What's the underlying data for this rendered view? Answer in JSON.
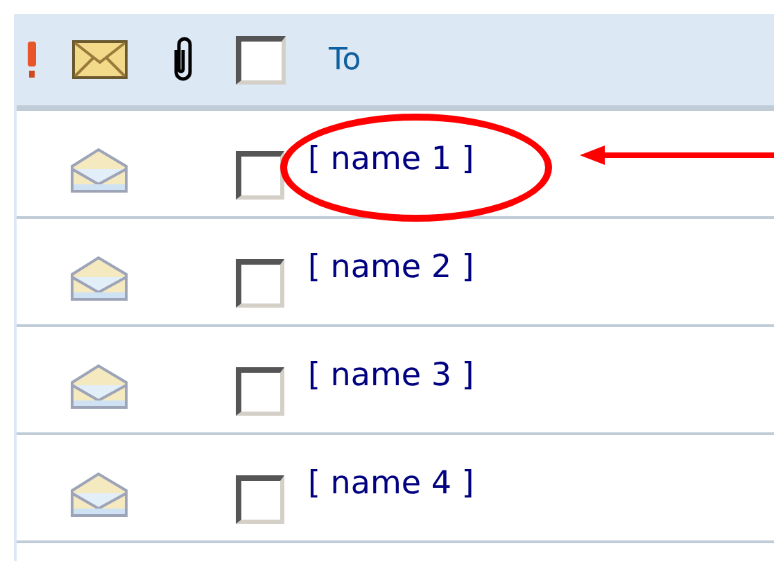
{
  "header": {
    "select_all_checked": false,
    "to_label": "To"
  },
  "rows": [
    {
      "name": "[ name 1 ]",
      "checked": false,
      "highlighted": true
    },
    {
      "name": "[ name 2 ]",
      "checked": false,
      "highlighted": false
    },
    {
      "name": "[ name 3 ]",
      "checked": false,
      "highlighted": false
    },
    {
      "name": "[ name 4 ]",
      "checked": false,
      "highlighted": false
    }
  ]
}
